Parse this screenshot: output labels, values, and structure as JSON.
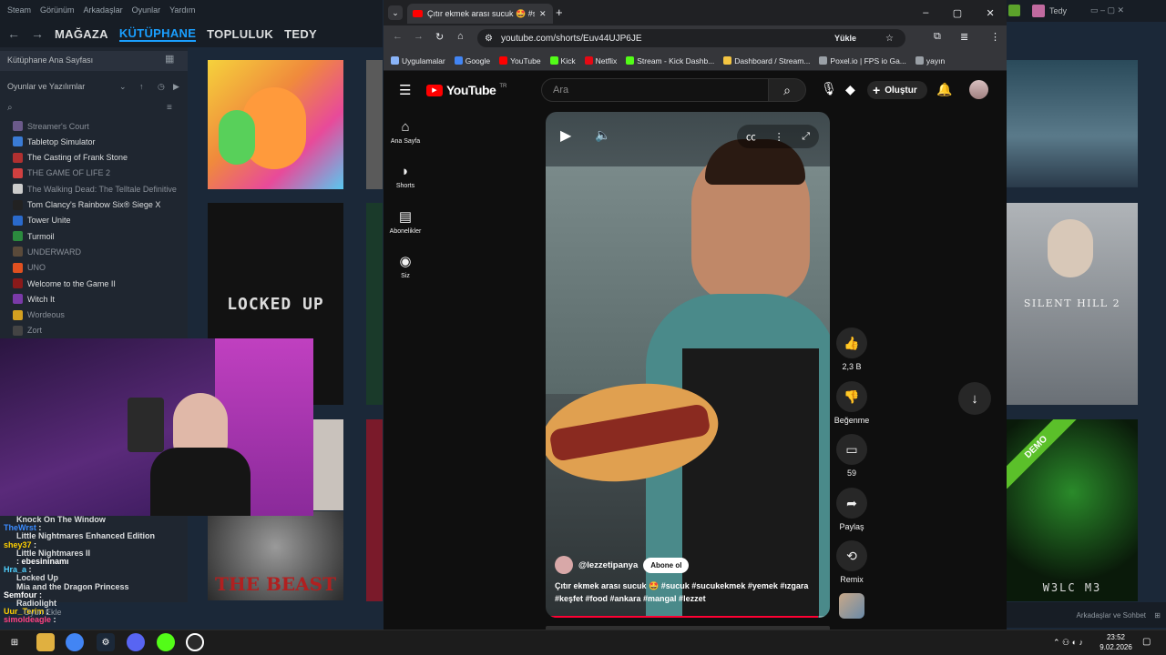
{
  "steam": {
    "menu": [
      "Steam",
      "Görünüm",
      "Arkadaşlar",
      "Oyunlar",
      "Yardım"
    ],
    "nav_tabs": [
      "MAĞAZA",
      "KÜTÜPHANE",
      "TOPLULUK",
      "TEDY"
    ],
    "library_home": "Kütüphane Ana Sayfası",
    "filter_label": "Oyunlar ve Yazılımlar",
    "games": [
      {
        "name": "Streamer's Court",
        "dim": true,
        "color": "#6b5a8a"
      },
      {
        "name": "Tabletop Simulator",
        "dim": false,
        "color": "#3a7bd5"
      },
      {
        "name": "The Casting of Frank Stone",
        "dim": false,
        "color": "#b03030"
      },
      {
        "name": "THE GAME OF LIFE 2",
        "dim": true,
        "color": "#d04040"
      },
      {
        "name": "The Walking Dead: The Telltale Definitive",
        "dim": true,
        "color": "#cccccc"
      },
      {
        "name": "Tom Clancy's Rainbow Six® Siege X",
        "dim": false,
        "color": "#222222"
      },
      {
        "name": "Tower Unite",
        "dim": false,
        "color": "#2a6acc"
      },
      {
        "name": "Turmoil",
        "dim": false,
        "color": "#2b8a3e"
      },
      {
        "name": "UNDERWARD",
        "dim": true,
        "color": "#5a4a3a"
      },
      {
        "name": "UNO",
        "dim": true,
        "color": "#e05020"
      },
      {
        "name": "Welcome to the Game II",
        "dim": false,
        "color": "#8a1a1a"
      },
      {
        "name": "Witch It",
        "dim": false,
        "color": "#7a3aa8"
      },
      {
        "name": "Wordeous",
        "dim": true,
        "color": "#d4a020"
      },
      {
        "name": "Zort",
        "dim": true,
        "color": "#444444"
      }
    ],
    "tile_locked": "LOCKED UP",
    "tile_beast": "THE BEAST",
    "tile_sh2": "SILENT HILL 2",
    "tile_demo": "DEMO",
    "tile_welcome": "W3LC  M3",
    "friends_chat": "Arkadaşlar ve Sohbet",
    "user": "Tedy",
    "add_game": "Oyun Ekle"
  },
  "chat": [
    {
      "user": "",
      "msg": "Knock On The Window",
      "color": "#dcdedf"
    },
    {
      "user": "TheWrst",
      "msg": ":",
      "color": "#3c8cff"
    },
    {
      "user": "",
      "msg": "Little Nightmares Enhanced Edition",
      "color": "#dcdedf"
    },
    {
      "user": "shey37",
      "msg": ":",
      "color": "#ffd000"
    },
    {
      "user": "",
      "msg": "Little Nightmares II",
      "color": "#dcdedf"
    },
    {
      "user": "",
      "msg": ": ebesininamı",
      "color": "#ffffff"
    },
    {
      "user": "Hra_a",
      "msg": ":",
      "color": "#4fd1ff"
    },
    {
      "user": "",
      "msg": "Locked Up",
      "color": "#dcdedf"
    },
    {
      "user": "",
      "msg": "Mia and the Dragon Princess",
      "color": "#dcdedf"
    },
    {
      "user": "Semfour",
      "msg": ":",
      "color": "#ffffff"
    },
    {
      "user": "",
      "msg": "Radiolight",
      "color": "#dcdedf"
    },
    {
      "user": "Uur_Terim",
      "msg": ":",
      "color": "#ffd000"
    },
    {
      "user": "simoldeagle",
      "msg": ":",
      "color": "#ff4080"
    }
  ],
  "chrome": {
    "tab_title": "Çıtır ekmek arası sucuk 🤩 #suc",
    "url": "youtube.com/shorts/Euv44UJP6JE",
    "upload": "Yükle",
    "bookmarks": [
      {
        "label": "Uygulamalar",
        "color": "#8ab4f8"
      },
      {
        "label": "Google",
        "color": "#4285f4"
      },
      {
        "label": "YouTube",
        "color": "#ff0000"
      },
      {
        "label": "Kick",
        "color": "#53fc18"
      },
      {
        "label": "Netflix",
        "color": "#e50914"
      },
      {
        "label": "Stream - Kick Dashb...",
        "color": "#53fc18"
      },
      {
        "label": "Dashboard / Stream...",
        "color": "#f4c542"
      },
      {
        "label": "Poxel.io | FPS io Ga...",
        "color": "#9aa0a6"
      },
      {
        "label": "yayın",
        "color": "#9aa0a6"
      }
    ]
  },
  "youtube": {
    "logo": "YouTube",
    "region": "TR",
    "search_placeholder": "Ara",
    "create": "Oluştur",
    "nav": [
      {
        "label": "Ana Sayfa",
        "icon": "home-icon"
      },
      {
        "label": "Shorts",
        "icon": "shorts-icon"
      },
      {
        "label": "Abonelikler",
        "icon": "subscriptions-icon"
      },
      {
        "label": "Siz",
        "icon": "you-icon"
      }
    ],
    "channel": "@lezzetipanya",
    "subscribe": "Abone ol",
    "caption_line1": "Çıtır ekmek arası sucuk 🤩 #sucuk #sucukekmek #yemek #ızgara",
    "caption_line2": "#keşfet #food #ankara #mangal #lezzet",
    "likes": "2,3 B",
    "dislike": "Beğenme",
    "comments": "59",
    "share": "Paylaş",
    "remix": "Remix",
    "progress": 0.97
  },
  "taskbar": {
    "time": "23:52",
    "date": "9.02.2026"
  }
}
